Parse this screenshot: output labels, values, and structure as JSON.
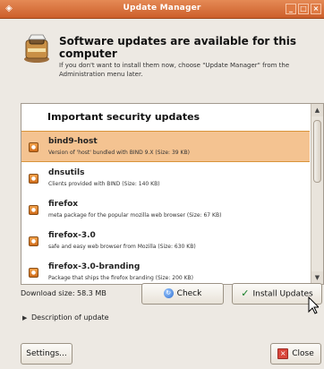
{
  "window": {
    "title": "Update Manager",
    "controls": [
      "minimize",
      "maximize",
      "close"
    ]
  },
  "header": {
    "title": "Software updates are available for this computer",
    "description": "If you don't want to install them now, choose \"Update Manager\" from the Administration menu later."
  },
  "updates": {
    "section_title": "Important security updates",
    "items": [
      {
        "name": "bind9-host",
        "description": "Version of 'host' bundled with BIND 9.X (Size: 39 KB)",
        "selected": true
      },
      {
        "name": "dnsutils",
        "description": "Clients provided with BIND (Size: 140 KB)",
        "selected": false
      },
      {
        "name": "firefox",
        "description": "meta package for the popular mozilla web browser (Size: 67 KB)",
        "selected": false
      },
      {
        "name": "firefox-3.0",
        "description": "safe and easy web browser from Mozilla (Size: 630 KB)",
        "selected": false
      },
      {
        "name": "firefox-3.0-branding",
        "description": "Package that ships the firefox branding (Size: 200 KB)",
        "selected": false
      }
    ]
  },
  "footer": {
    "download_size": "Download size: 58.3 MB",
    "check_label": "Check",
    "install_label": "Install Updates",
    "description_label": "Description of update",
    "settings_label": "Settings...",
    "close_label": "Close"
  },
  "colors": {
    "titlebar": "#d96c35",
    "selection": "#f4c391",
    "accent": "#cf6c1b"
  },
  "icons": {
    "window": "package-icon",
    "item": "security-update-icon",
    "check": "refresh-icon",
    "install": "checkmark-icon",
    "close": "close-icon"
  }
}
